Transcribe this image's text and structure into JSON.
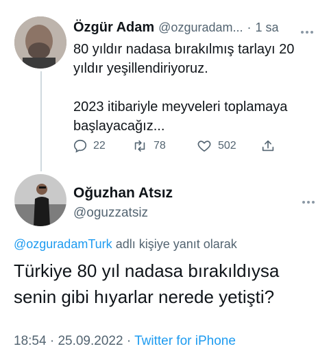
{
  "colors": {
    "accent": "#1d9bf0",
    "muted": "#536471",
    "text": "#0f1419",
    "line": "#cfd9de"
  },
  "parent_tweet": {
    "author_name": "Özgür Adam",
    "author_handle": "@ozguradam...",
    "separator": "·",
    "time": "1 sa",
    "text_line1": "80 yıldır nadasa bırakılmış tarlayı 20",
    "text_line2": "yıldır yeşillendiriyoruz.",
    "text_line3": "2023 itibariyle meyveleri toplamaya",
    "text_line4": "başlayacağız...",
    "actions": {
      "reply_icon": "reply-icon",
      "reply_count": "22",
      "retweet_icon": "retweet-icon",
      "retweet_count": "78",
      "like_icon": "heart-icon",
      "like_count": "502",
      "share_icon": "share-icon"
    }
  },
  "reply_tweet": {
    "author_name": "Oğuzhan Atsız",
    "author_handle": "@oguzzatsiz",
    "reply_to_handle": "@ozguradamTurk",
    "reply_to_suffix": "adlı kişiye yanıt olarak",
    "text_line1": "Türkiye 80 yıl nadasa bırakıldıysa",
    "text_line2": "senin gibi hıyarlar nerede yetişti?",
    "time": "18:54",
    "date": "25.09.2022",
    "source": "Twitter for iPhone",
    "separator": "·"
  }
}
